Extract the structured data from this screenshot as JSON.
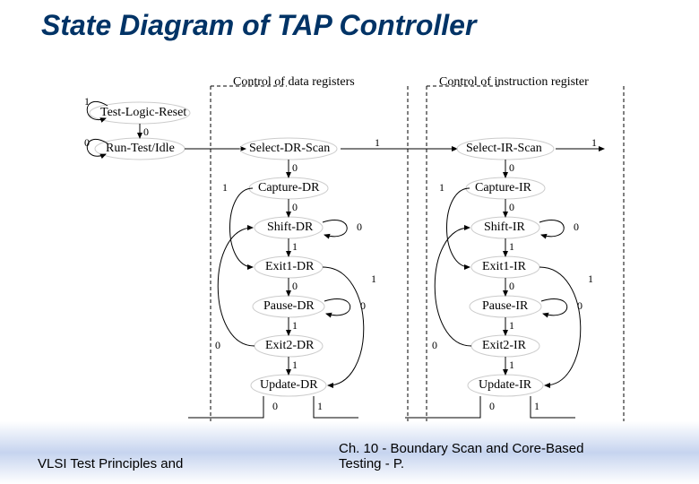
{
  "title": "State Diagram of TAP Controller",
  "headers": {
    "dr": "Control of data registers",
    "ir": "Control of instruction register"
  },
  "states": {
    "tlr": "Test-Logic-Reset",
    "rti": "Run-Test/Idle",
    "sel_dr": "Select-DR-Scan",
    "cap_dr": "Capture-DR",
    "shift_dr": "Shift-DR",
    "exit1_dr": "Exit1-DR",
    "pause_dr": "Pause-DR",
    "exit2_dr": "Exit2-DR",
    "update_dr": "Update-DR",
    "sel_ir": "Select-IR-Scan",
    "cap_ir": "Capture-IR",
    "shift_ir": "Shift-IR",
    "exit1_ir": "Exit1-IR",
    "pause_ir": "Pause-IR",
    "exit2_ir": "Exit2-IR",
    "update_ir": "Update-IR"
  },
  "labels": {
    "l0": "0",
    "l1": "1"
  },
  "footer": {
    "left": "VLSI Test Principles and",
    "right": "Ch. 10 - Boundary Scan and Core-Based\nTesting - P."
  }
}
